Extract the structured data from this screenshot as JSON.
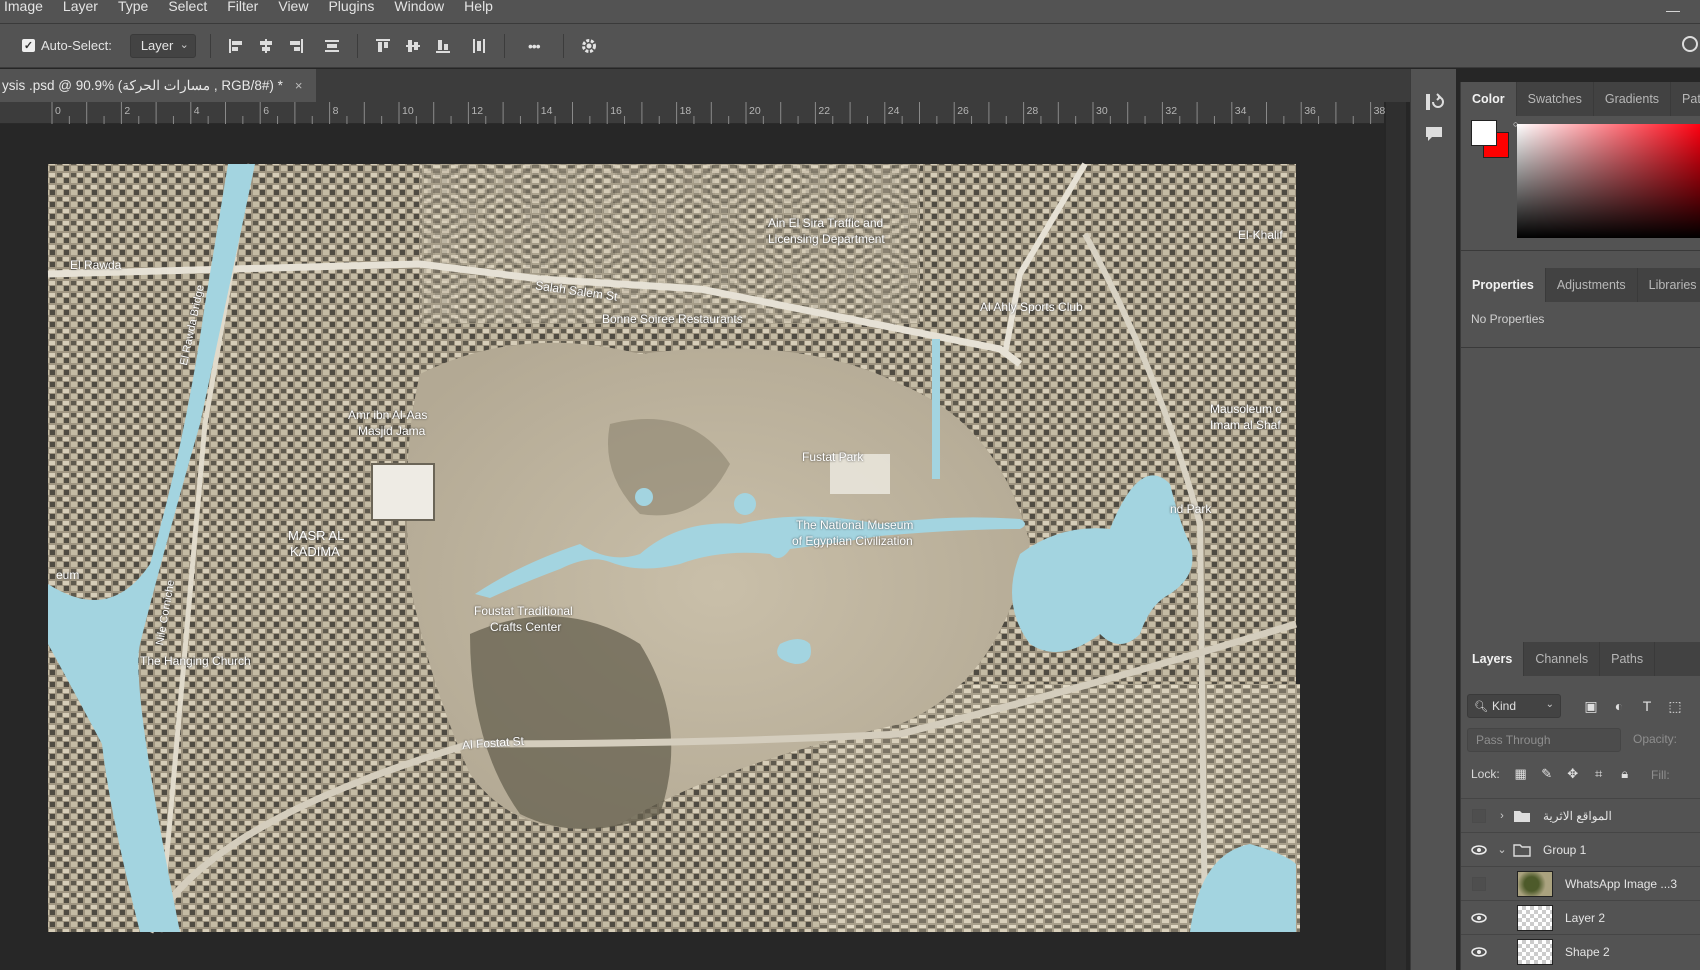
{
  "menu": [
    "Image",
    "Layer",
    "Type",
    "Select",
    "Filter",
    "View",
    "Plugins",
    "Window",
    "Help"
  ],
  "options": {
    "auto_select_label": "Auto-Select:",
    "auto_select_checked": true,
    "auto_select_target": "Layer",
    "more_label": "•••"
  },
  "document": {
    "tab_title": "ysis .psd @ 90.9% (مسارات الحركة , RGB/8#) *",
    "close_glyph": "×"
  },
  "ruler_numbers": [
    "0",
    "2",
    "4",
    "6",
    "8",
    "10",
    "12",
    "14",
    "16",
    "18",
    "20",
    "22",
    "24",
    "26",
    "28",
    "30",
    "32",
    "34",
    "36",
    "38"
  ],
  "map_labels": {
    "el_rawda": "El Rawda",
    "rawda_bridge": "El Rawda Bridge",
    "ain_el_sira": "Ain El Sira Traffic and",
    "ain_el_sira_2": "Licensing Department",
    "salah_salem": "Salah Salem St",
    "bonne_soiree": "Bonne Soiree Restaurants",
    "al_ahly": "Al Ahly Sports Club",
    "el_khalifa": "El-Khalif",
    "amr": "Amr ibn Al-Aas",
    "amr_2": "Masjid Jama",
    "mausoleum": "Mausoleum o",
    "mausoleum_2": "Imam al Shaf",
    "fustat_park": "Fustat Park",
    "museum": "The National Museum",
    "museum_2": "of Egyptian Civilization",
    "nd_park": "nd Park",
    "masr": "MASR AL",
    "masr_2": "KADIMA",
    "eum": "eum",
    "nile": "Nile Corniche",
    "foustat": "Foustat Traditional",
    "foustat_2": "Crafts Center",
    "hanging": "The Hanging Church",
    "al_fostat": "Al Fostat St"
  },
  "panels": {
    "color_tabs": [
      "Color",
      "Swatches",
      "Gradients",
      "Pat"
    ],
    "props_tabs": [
      "Properties",
      "Adjustments",
      "Libraries"
    ],
    "no_properties": "No Properties",
    "layers_tabs": [
      "Layers",
      "Channels",
      "Paths"
    ],
    "kind_label": "Kind",
    "blend_mode": "Pass Through",
    "opacity_label": "Opacity:",
    "lock_label": "Lock:",
    "fill_label": "Fill:",
    "foreground_color": "#ffffff",
    "background_color": "#ff0000"
  },
  "layers": [
    {
      "name": "المواقع الاثرية",
      "type": "group",
      "visible": false,
      "expanded": false
    },
    {
      "name": "Group 1",
      "type": "group",
      "visible": true,
      "expanded": true
    },
    {
      "name": "WhatsApp Image ...3",
      "type": "image",
      "visible": false
    },
    {
      "name": "Layer 2",
      "type": "layer",
      "visible": true
    },
    {
      "name": "Shape 2",
      "type": "shape",
      "visible": true
    }
  ]
}
